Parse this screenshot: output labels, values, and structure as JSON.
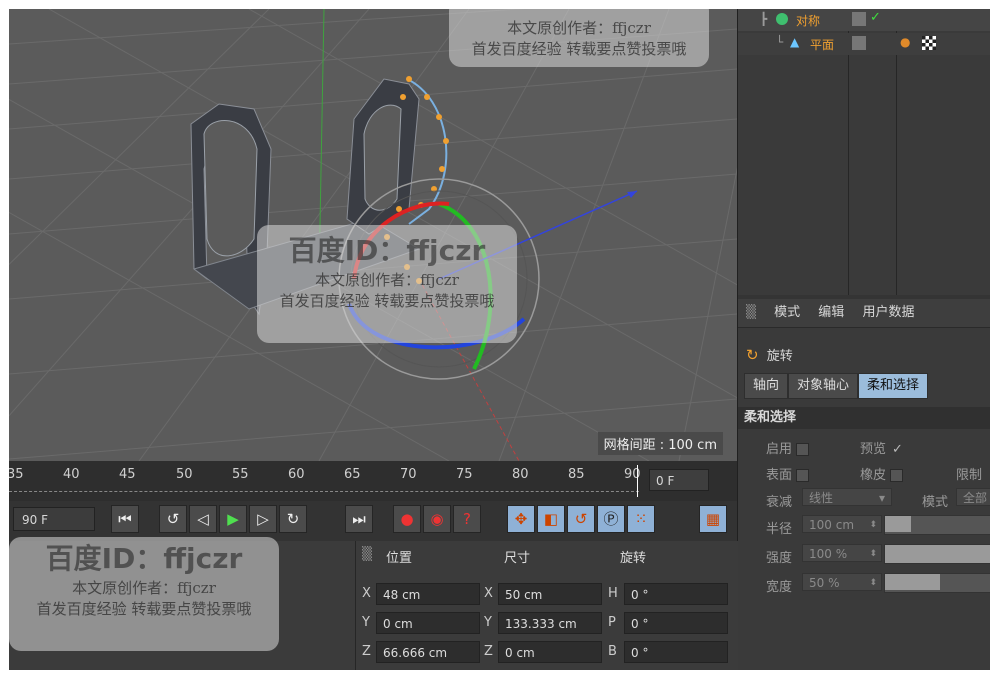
{
  "viewport": {
    "grid_spacing": "网格间距 : 100 cm"
  },
  "objects": [
    {
      "name": "对称",
      "check": "✓"
    },
    {
      "name": "平面"
    }
  ],
  "attributes": {
    "menu": [
      "模式",
      "编辑",
      "用户数据"
    ],
    "object_title": "旋转",
    "tabs": [
      "轴向",
      "对象轴心",
      "柔和选择"
    ],
    "section": "柔和选择",
    "enable_label": "启用",
    "preview_label": "预览",
    "preview_check": "✓",
    "surface_label": "表面",
    "rubber_label": "橡皮",
    "limit_label": "限制",
    "falloff_label": "衰减",
    "falloff_value": "线性",
    "mode_label": "模式",
    "mode_value": "全部",
    "radius_label": "半径",
    "radius_value": "100 cm",
    "strength_label": "强度",
    "strength_value": "100 %",
    "width_label": "宽度",
    "width_value": "50 %"
  },
  "timeline": {
    "ticks": [
      "35",
      "40",
      "45",
      "50",
      "55",
      "60",
      "65",
      "70",
      "75",
      "80",
      "85",
      "90"
    ],
    "current_frame": "0 F",
    "end_frame": "90 F"
  },
  "coords": {
    "headers": {
      "position": "位置",
      "size": "尺寸",
      "rotation": "旋转"
    },
    "rows": [
      {
        "axis": "X",
        "pos": "48 cm",
        "saxis": "X",
        "size": "50 cm",
        "raxis": "H",
        "rot": "0 °"
      },
      {
        "axis": "Y",
        "pos": "0 cm",
        "saxis": "Y",
        "size": "133.333 cm",
        "raxis": "P",
        "rot": "0 °"
      },
      {
        "axis": "Z",
        "pos": "66.666 cm",
        "saxis": "Z",
        "size": "0 cm",
        "raxis": "B",
        "rot": "0 °"
      }
    ]
  },
  "watermark": {
    "id": "百度ID：ffjczr",
    "author": "本文原创作者：ffjczr",
    "note": "首发百度经验 转载要点赞投票哦"
  }
}
